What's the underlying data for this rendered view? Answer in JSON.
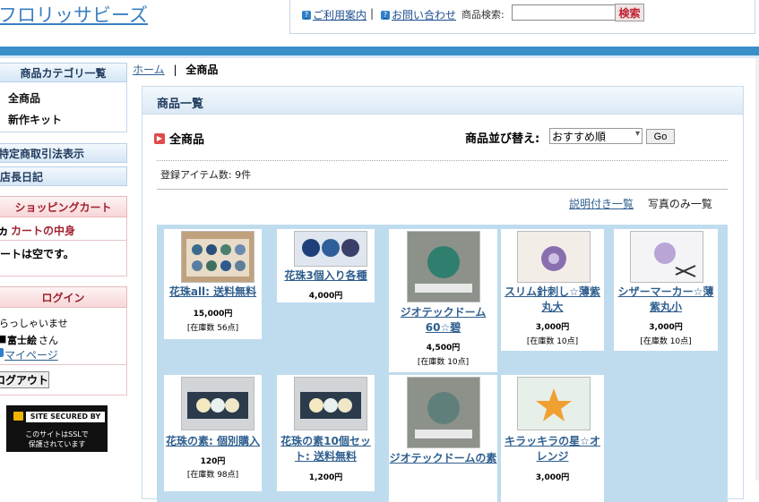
{
  "header": {
    "logo": "フロリッサビーズ",
    "guide_link": "ご利用案内",
    "contact_link": "お問い合わせ",
    "separator": "|",
    "search_label": "商品検索:",
    "search_value": "",
    "search_button": "検索"
  },
  "sidebar": {
    "category_head": "商品カテゴリ一覧",
    "categories": [
      "全商品",
      "新作キット"
    ],
    "tokutei": "特定商取引法表示",
    "diary": "店長日記",
    "cart_head": "ショッピングカート",
    "cart_sub": "カートの中身",
    "cart_empty": "カートは空です。",
    "login_head": "ログイン",
    "welcome": "いらっしゃいませ",
    "user_name": "富士絵",
    "user_suffix": "さん",
    "mypage": "マイページ",
    "logout": "ログアウト",
    "ssl_title": "SITE SECURED BY SSL",
    "ssl_line1": "このサイトはSSLで",
    "ssl_line2": "保護されています"
  },
  "breadcrumb": {
    "home": "ホーム",
    "sep": "|",
    "current": "全商品"
  },
  "main": {
    "panel_title": "商品一覧",
    "category_title": "全商品",
    "sort_label": "商品並び替え:",
    "sort_selected": "おすすめ順",
    "sort_go": "Go",
    "item_count": "登録アイテム数: 9件",
    "view_detail": "説明付き一覧",
    "view_photo": "写真のみ一覧"
  },
  "products": [
    {
      "name": "花珠all: 送料無料",
      "price": "15,000円",
      "stock": "[在庫数 56点]"
    },
    {
      "name": "花珠3個入り各種",
      "price": "4,000円",
      "stock": ""
    },
    {
      "name": "ジオテックドーム60☆碧",
      "price": "4,500円",
      "stock": "[在庫数 10点]"
    },
    {
      "name": "スリム針刺し☆薄紫丸大",
      "price": "3,000円",
      "stock": "[在庫数 10点]"
    },
    {
      "name": "シザーマーカー☆薄紫丸小",
      "price": "3,000円",
      "stock": "[在庫数 10点]"
    },
    {
      "name": "花珠の素: 個別購入",
      "price": "120円",
      "stock": "[在庫数 98点]"
    },
    {
      "name": "花珠の素10個セット: 送料無料",
      "price": "1,200円",
      "stock": ""
    },
    {
      "name": "ジオテックドームの素",
      "price": "",
      "stock": ""
    },
    {
      "name": "キラッキラの星☆オレンジ",
      "price": "3,000円",
      "stock": ""
    }
  ]
}
